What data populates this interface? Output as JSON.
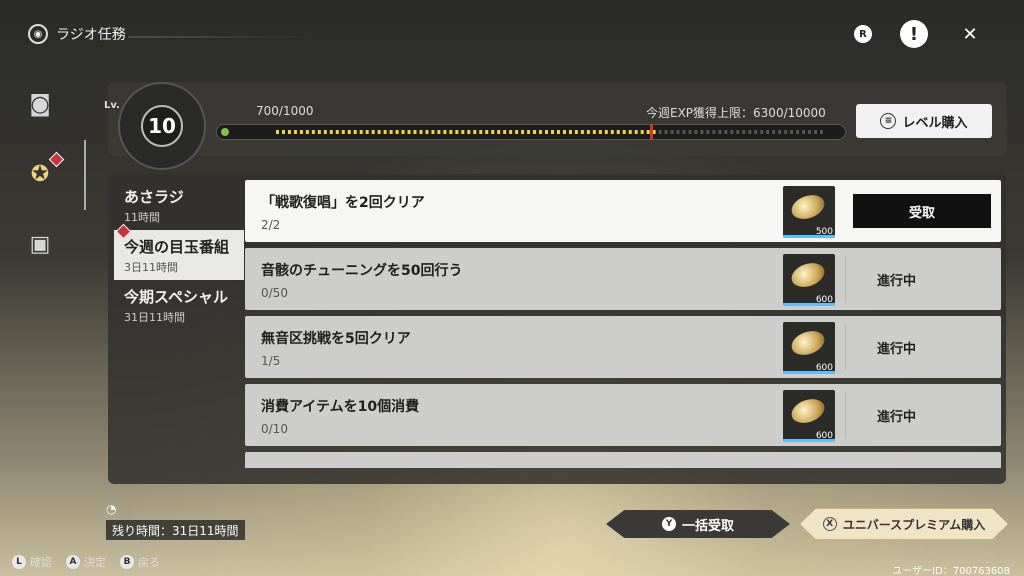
{
  "header": {
    "title": "ラジオ任務"
  },
  "level": {
    "lv_label": "Lv.",
    "value": "10",
    "exp_current": "700/1000",
    "exp_fraction": 0.7,
    "weekly_limit": "今週EXP獲得上限：6300/10000",
    "buy_button": "レベル購入"
  },
  "categories": [
    {
      "name": "あさラジ",
      "time": "11時間"
    },
    {
      "name": "今週の目玉番組",
      "time": "3日11時間"
    },
    {
      "name": "今期スペシャル",
      "time": "31日11時間"
    }
  ],
  "tasks": [
    {
      "title": "「戦歌復唱」を2回クリア",
      "progress": "2/2",
      "reward": "500",
      "action": "受取"
    },
    {
      "title": "音骸のチューニングを50回行う",
      "progress": "0/50",
      "reward": "600",
      "action": "進行中"
    },
    {
      "title": "無音区挑戦を5回クリア",
      "progress": "1/5",
      "reward": "600",
      "action": "進行中"
    },
    {
      "title": "消費アイテムを10個消費",
      "progress": "0/10",
      "reward": "600",
      "action": "進行中"
    }
  ],
  "footer": {
    "remaining": "残り時間：31日11時間",
    "bulk_key": "Y",
    "bulk_label": "一括受取",
    "premium_key": "X",
    "premium_label": "ユニバースプレミアム購入",
    "hints": [
      {
        "key": "L",
        "label": "確認"
      },
      {
        "key": "A",
        "label": "決定"
      },
      {
        "key": "B",
        "label": "戻る"
      }
    ],
    "user_id": "ユーザーID：700763608"
  }
}
